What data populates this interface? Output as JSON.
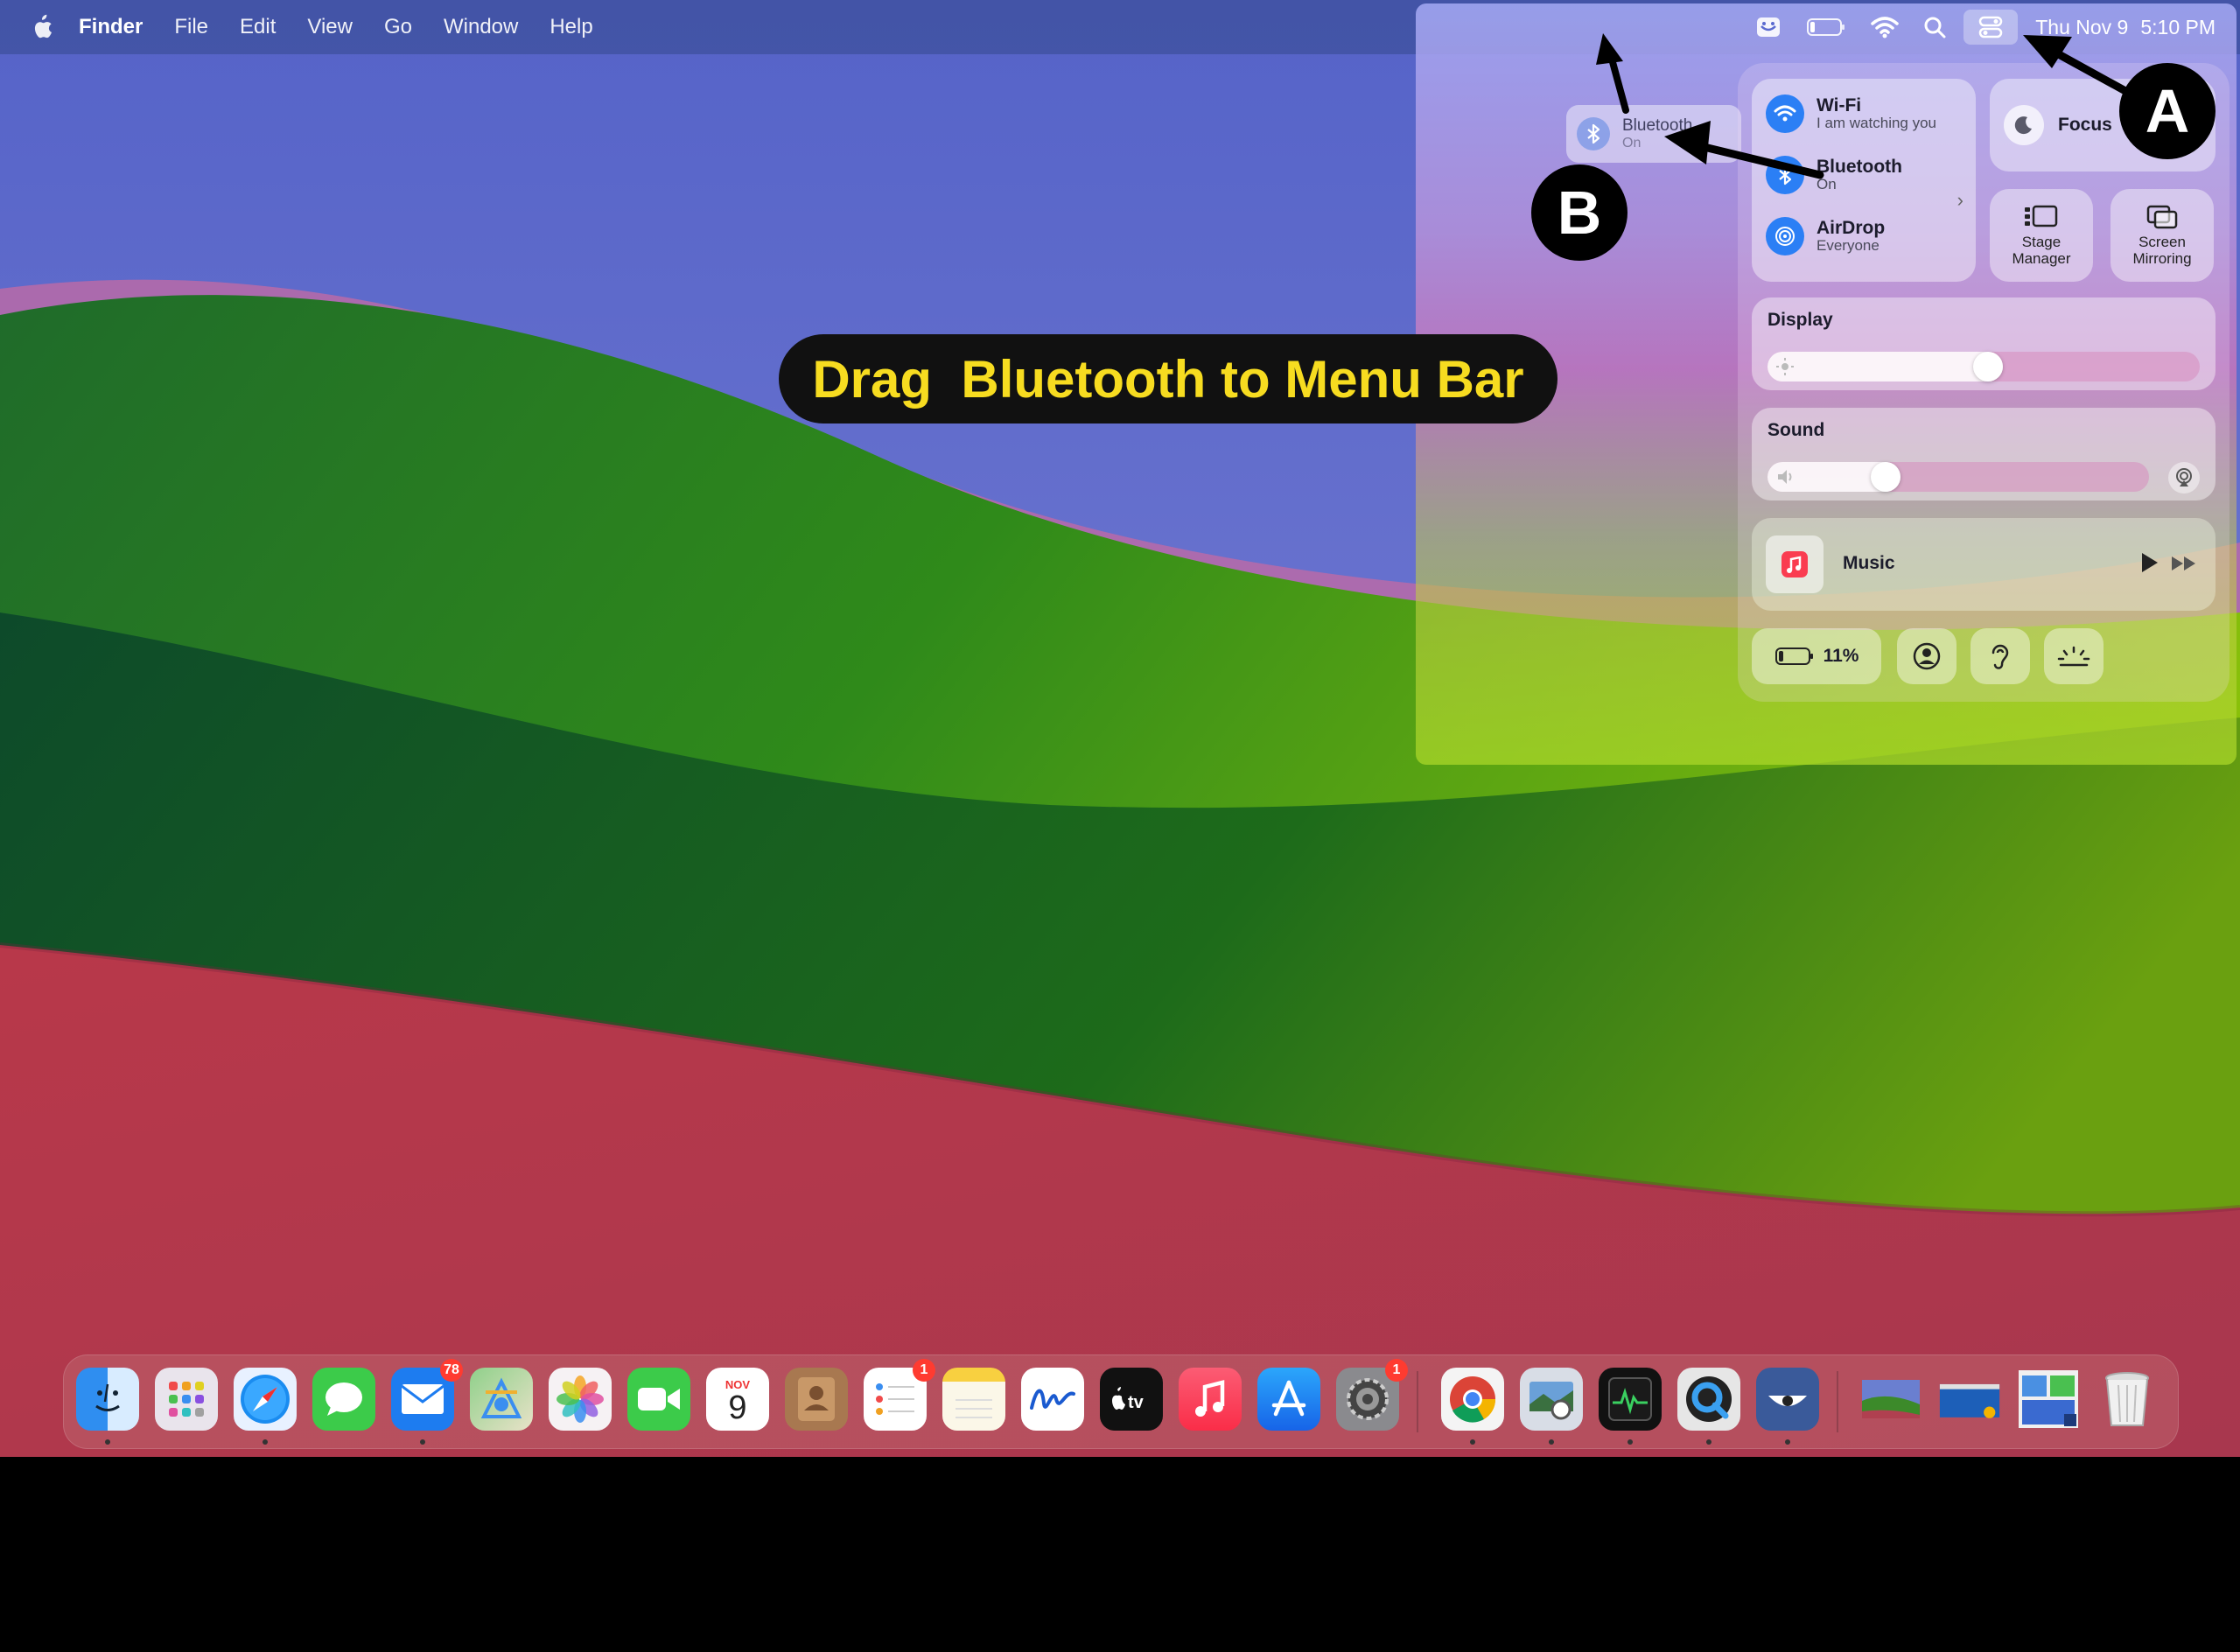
{
  "menubar": {
    "apple_icon": "apple-logo-icon",
    "app_name": "Finder",
    "items": [
      "File",
      "Edit",
      "View",
      "Go",
      "Window",
      "Help"
    ],
    "status_icons": [
      "screen-share-icon",
      "battery-icon",
      "wifi-icon",
      "search-icon",
      "control-center-icon"
    ],
    "clock": {
      "date": "Thu Nov 9",
      "time": "5:10 PM"
    }
  },
  "drag_preview": {
    "title": "Bluetooth",
    "subtitle": "On"
  },
  "control_center": {
    "wifi": {
      "title": "Wi-Fi",
      "subtitle": "I am watching you"
    },
    "bluetooth": {
      "title": "Bluetooth",
      "subtitle": "On"
    },
    "airdrop": {
      "title": "AirDrop",
      "subtitle": "Everyone"
    },
    "focus": {
      "label": "Focus"
    },
    "stage_manager": {
      "label_line1": "Stage",
      "label_line2": "Manager"
    },
    "screen_mirroring": {
      "label_line1": "Screen",
      "label_line2": "Mirroring"
    },
    "display": {
      "title": "Display",
      "level": 0.51
    },
    "sound": {
      "title": "Sound",
      "level": 0.31
    },
    "music": {
      "title": "Music"
    },
    "battery": {
      "percent": "11%"
    }
  },
  "annotations": {
    "badge_a": "A",
    "badge_b": "B",
    "instruction": "Drag  Bluetooth to Menu Bar"
  },
  "dock": {
    "mail_badge": "78",
    "reminders_badge": "1",
    "settings_badge": "1",
    "calendar_month": "NOV",
    "calendar_day": "9"
  },
  "colors": {
    "instruction_text": "#f7dc20",
    "accent_blue": "#2b7ff5",
    "badge_red": "#ff3b30"
  }
}
